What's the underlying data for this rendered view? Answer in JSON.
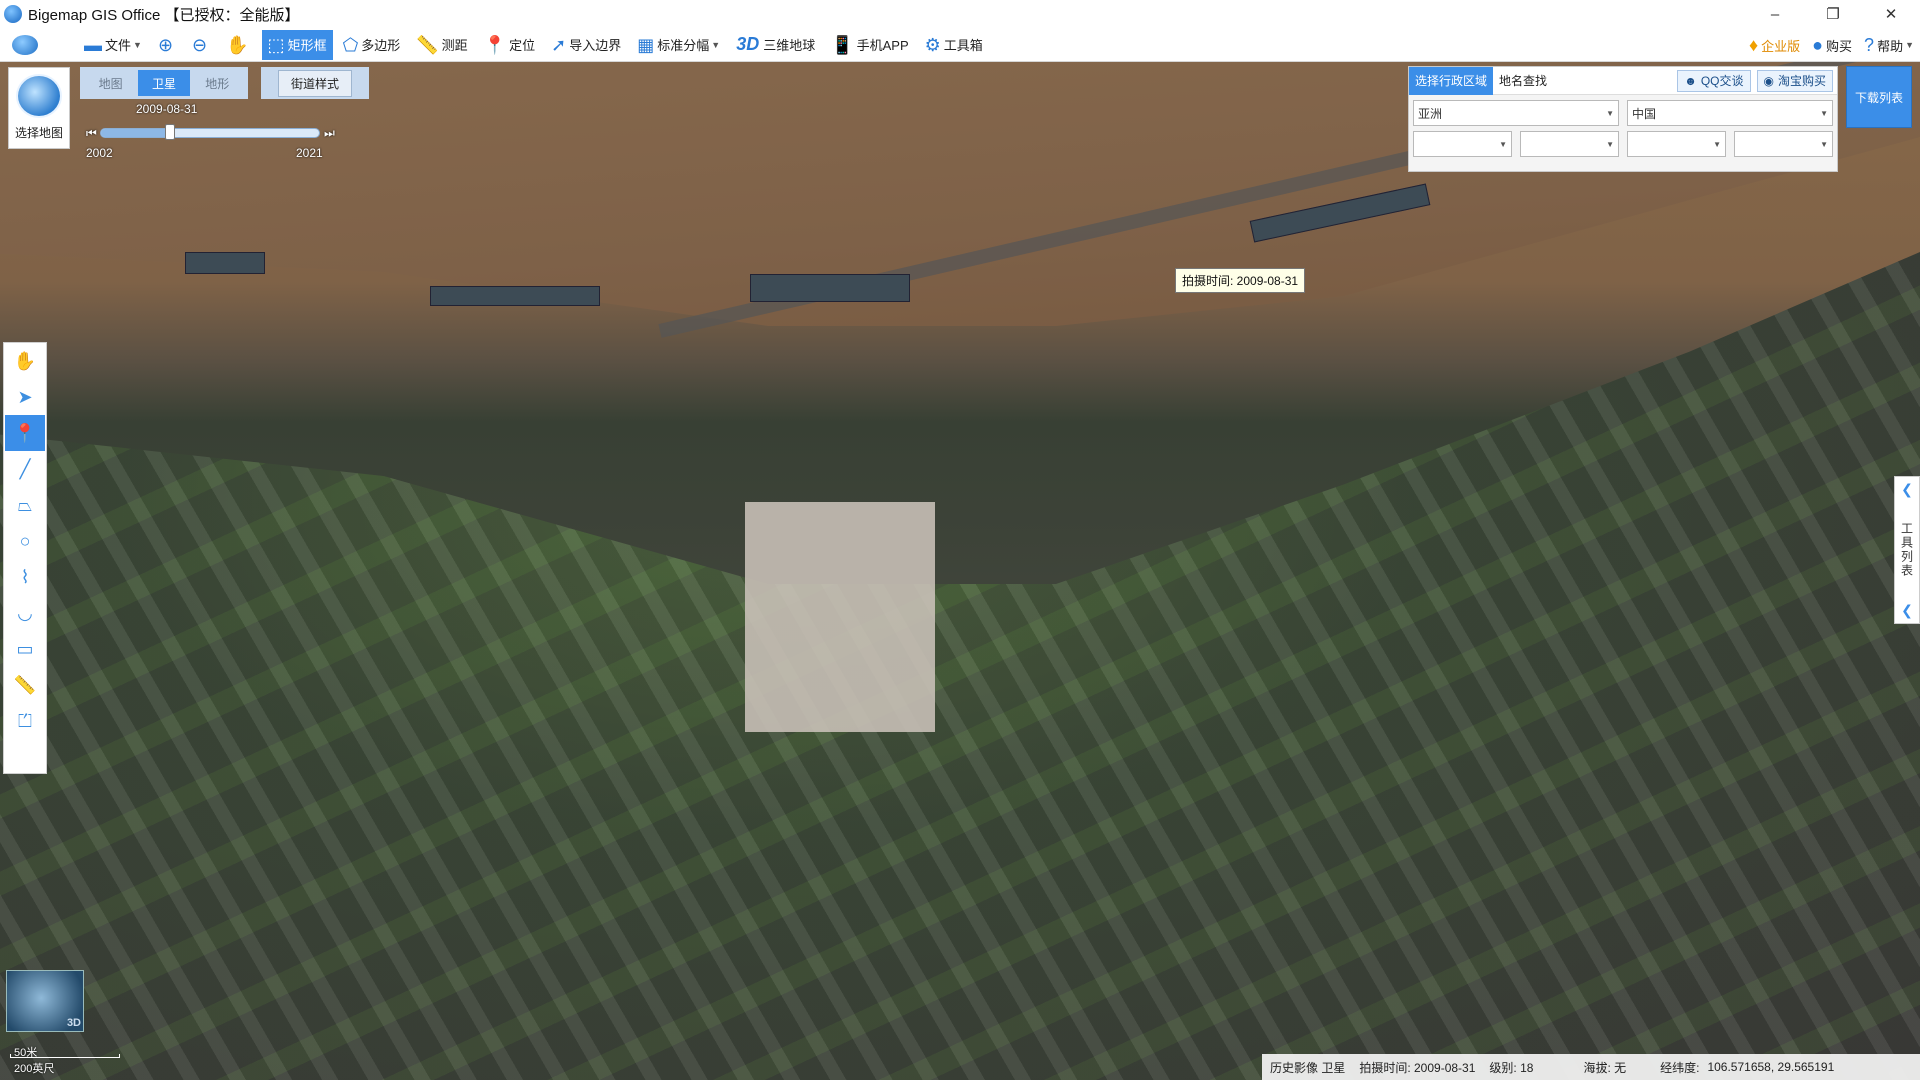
{
  "app": {
    "title": "Bigemap GIS Office 【已授权：全能版】"
  },
  "window_controls": {
    "minimize": "–",
    "restore": "❐",
    "close": "✕"
  },
  "toolbar": {
    "file": "文件",
    "rect_select": "矩形框",
    "polygon": "多边形",
    "measure": "测距",
    "locate": "定位",
    "import_boundary": "导入边界",
    "grid": "标准分幅",
    "globe_3d_prefix": "3D",
    "globe_3d": "三维地球",
    "mobile_app": "手机APP",
    "toolbox": "工具箱",
    "enterprise": "企业版",
    "buy": "购买",
    "help": "帮助"
  },
  "map_selector": {
    "label": "选择地图"
  },
  "map_types": [
    "地图",
    "卫星",
    "地形"
  ],
  "map_type_selected": "卫星",
  "street_style": "街道样式",
  "timeline": {
    "date": "2009-08-31",
    "start_year": "2002",
    "end_year": "2021",
    "position": 0.32
  },
  "region_panel": {
    "tab_region": "选择行政区域",
    "tab_search": "地名查找",
    "qq": "QQ交谈",
    "taobao": "淘宝购买",
    "continent": "亚洲",
    "country": "中国",
    "level3": "",
    "level4": "",
    "level5": "",
    "level6": ""
  },
  "download_list": "下载列表",
  "tooltip": "拍摄时间: 2009-08-31",
  "right_panel": {
    "label": "工具列表"
  },
  "minimap": {
    "label": "3D"
  },
  "scale": {
    "metric": "50米",
    "imperial": "200英尺"
  },
  "status": {
    "history": "历史影像 卫星",
    "capture_time": "拍摄时间: 2009-08-31",
    "level": "级别:  18",
    "altitude": "海拔: 无",
    "coords_label": "经纬度:",
    "coords": "106.571658, 29.565191"
  },
  "icons": {
    "file": "folder-icon",
    "zoom_in": "zoom-in-icon",
    "zoom_out": "zoom-out-icon",
    "pan": "hand-icon",
    "rect": "rectangle-select-icon",
    "polygon": "polygon-icon",
    "measure": "ruler-icon",
    "locate": "pin-icon",
    "import": "import-arrow-icon",
    "grid": "grid-icon",
    "mobile": "phone-icon",
    "toolbox": "gear-icon",
    "enterprise": "diamond-icon",
    "buy": "buy-icon",
    "help": "help-icon"
  },
  "colors": {
    "accent": "#3b8ee8",
    "enterprise": "#e08a00"
  }
}
